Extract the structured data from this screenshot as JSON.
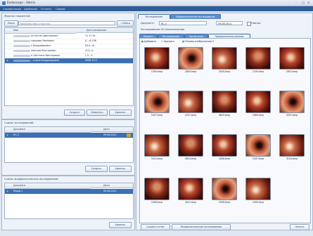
{
  "window": {
    "title": "Endoscope - Admin",
    "controls": [
      "–",
      "□",
      "✕"
    ]
  },
  "menu": [
    "Справочники",
    "Шаблоны",
    "Отчеты",
    "Сервис"
  ],
  "patients": {
    "section_title": "Журнал пациентов",
    "search_button": "Поиск",
    "search_placeholder": "Фамилия Имя Отчество",
    "find_button": "Найти",
    "columns": [
      "Имя",
      "Дата рождения"
    ],
    "rows": [
      {
        "name": "астантин Дмитриевич",
        "date": "21.1?.19.."
      },
      {
        "name": "ладимир Иванович",
        "date": "0...:6.198"
      },
      {
        "name": "с Владимирович",
        "date": "03.0..:6.."
      },
      {
        "name": "анислав Викторович",
        "date": "!5.0_.е.."
      },
      {
        "name": "а Светлана Викторовна",
        "date": "L.5.-.1.."
      },
      {
        "name": "...ктина Владимировна",
        "date": "0998.19.3",
        "selected": true
      }
    ],
    "buttons": [
      "Создать",
      "Изменить",
      "Удалить"
    ]
  },
  "studies": {
    "section_title": "Список исследований",
    "columns": [
      "Документ",
      "Дата"
    ],
    "rows": [
      {
        "doc": "КС-2",
        "date": "09.06.2011",
        "selected": true
      }
    ],
    "buttons": [
      "Создать",
      "Удалить"
    ]
  },
  "morph": {
    "section_title": "Список морфологических исследований",
    "columns": [
      "Документ",
      "Дата"
    ],
    "rows": [
      {
        "doc": "Морф-1",
        "date": "09.06.2011",
        "selected": true
      }
    ],
    "buttons": [
      "Удалить"
    ]
  },
  "exam": {
    "tabs": [
      "Исследование",
      "Морфологическое исследование"
    ],
    "document_label": "Документ:",
    "document_value": "КС-2",
    "date_value": "09.06.2011",
    "repeat_label": "Повтор",
    "study_label": "Исследование:",
    "study_value": "КС-Колоноскопия",
    "subtabs": [
      "Пациент",
      "Исследование",
      "Заключение",
      "Прикрепленные данные"
    ],
    "toolbar": {
      "add": "Добавить",
      "delete": "Удалить",
      "size": "Размер изображения"
    },
    "thumbnails": [
      "1395.bmp",
      "2890.bmp",
      "2945.bmp",
      "1195.bmp",
      "2853.bmp",
      "1947.bmp",
      "2207.bmp",
      "4820.bmp",
      "2960.bmp",
      "3297.bmp",
      "1914.bmp",
      "4824.bmp",
      "1828.bmp",
      "2167.bmp",
      "3104.bmp",
      "1096.bmp",
      "4047.bmp",
      "2958.bmp",
      "1095.bmp"
    ],
    "bottom_buttons": [
      "Создать отчет",
      "Морфологическое исследование",
      "Печать"
    ]
  },
  "colors": {
    "menu": "#2f5d95",
    "selection": "#3c6fb3",
    "tab": "#5b8ed0"
  }
}
